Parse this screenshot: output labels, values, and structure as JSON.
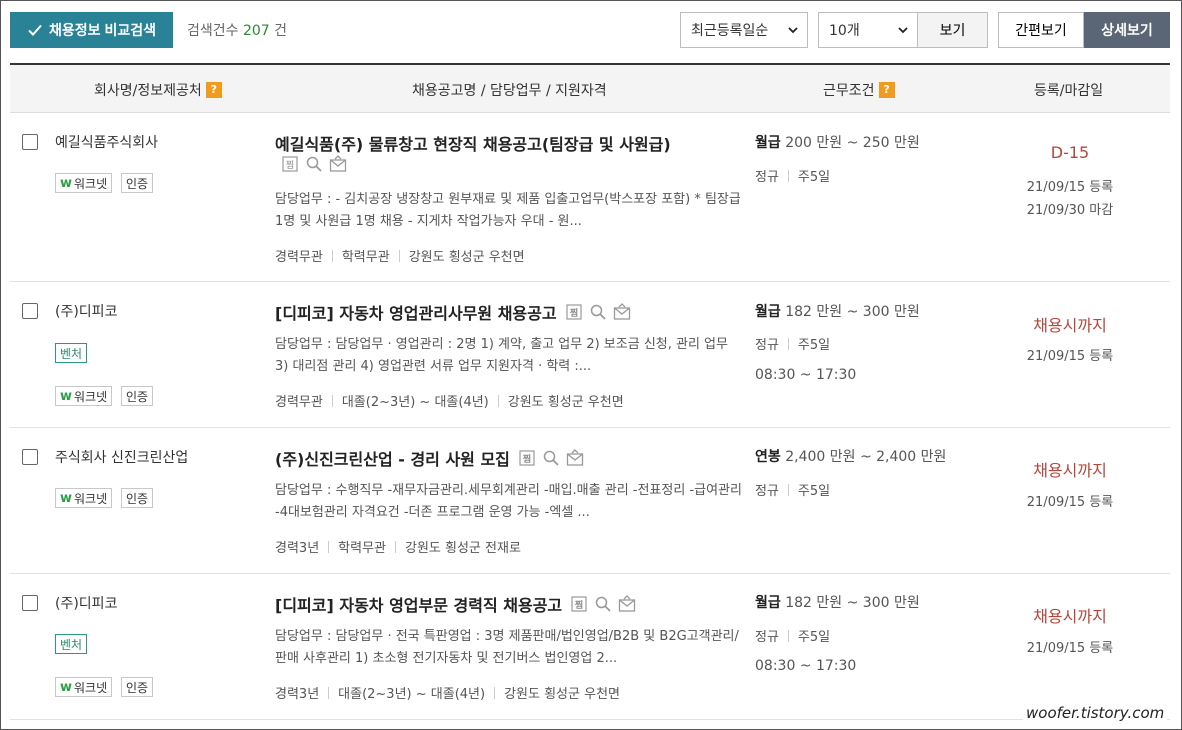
{
  "toolbar": {
    "compare_label": "채용정보 비교검색",
    "result_prefix": "검색건수",
    "result_count": "207",
    "result_suffix": "건",
    "sort_selected": "최근등록일순",
    "count_selected": "10개",
    "view_label": "보기",
    "simple_view_label": "간편보기",
    "detail_view_label": "상세보기"
  },
  "headers": {
    "company": "회사명/정보제공처",
    "title": "채용공고명 / 담당업무 / 지원자격",
    "condition": "근무조건",
    "date": "등록/마감일",
    "help_mark": "?"
  },
  "badges": {
    "worknet_mark": "w",
    "worknet": "워크넷",
    "certified": "인증",
    "venture": "벤처"
  },
  "rows": [
    {
      "company": "예길식품주식회사",
      "title": "예길식품(주) 물류창고 현장직 채용공고(팀장급 및 사원급)",
      "duty": "담당업무 : - 김치공장 냉장창고 원부재료 및 제품 입출고업무(박스포장 포함) * 팀장급 1명 및 사원급 1명 채용 - 지게차 작업가능자 우대 - 원...",
      "career": "경력무관",
      "education": "학력무관",
      "location": "강원도 횡성군 우천면",
      "pay_type": "월급",
      "pay_range": "200 만원 ~ 250 만원",
      "employment": "정규",
      "week": "주5일",
      "deadline": "D-15",
      "registered": "21/09/15 등록",
      "closing": "21/09/30 마감"
    },
    {
      "company": "(주)디피코",
      "title": "[디피코] 자동차 영업관리사무원 채용공고",
      "duty": "담당업무 : 담당업무 · 영업관리 : 2명 1) 계약, 출고 업무 2) 보조금 신청, 관리 업무 3) 대리점 관리 4) 영업관련 서류 업무 지원자격 · 학력 :...",
      "career": "경력무관",
      "education": "대졸(2~3년) ~ 대졸(4년)",
      "location": "강원도 횡성군 우천면",
      "pay_type": "월급",
      "pay_range": "182 만원 ~ 300 만원",
      "employment": "정규",
      "week": "주5일",
      "hours": "08:30 ~ 17:30",
      "deadline": "채용시까지",
      "registered": "21/09/15 등록"
    },
    {
      "company": "주식회사 신진크린산업",
      "title": "(주)신진크린산업 - 경리 사원 모집",
      "duty": "담당업무 : 수행직무 -재무자금관리.세무회계관리 -매입.매출 관리 -전표정리 -급여관리 -4대보험관리 자격요건 -더존 프로그램 운영 가능 -엑셀 ...",
      "career": "경력3년",
      "education": "학력무관",
      "location": "강원도 횡성군 전재로",
      "pay_type": "연봉",
      "pay_range": "2,400 만원 ~ 2,400 만원",
      "employment": "정규",
      "week": "주5일",
      "deadline": "채용시까지",
      "registered": "21/09/15 등록"
    },
    {
      "company": "(주)디피코",
      "title": "[디피코] 자동차 영업부문 경력직 채용공고",
      "duty": "담당업무 : 담당업무 · 전국 특판영업 : 3명 제품판매/법인영업/B2B 및 B2G고객관리/판매 사후관리 1) 초소형 전기자동차 및 전기버스 법인영업 2...",
      "career": "경력3년",
      "education": "대졸(2~3년) ~ 대졸(4년)",
      "location": "강원도 횡성군 우천면",
      "pay_type": "월급",
      "pay_range": "182 만원 ~ 300 만원",
      "employment": "정규",
      "week": "주5일",
      "hours": "08:30 ~ 17:30",
      "deadline": "채용시까지",
      "registered": "21/09/15 등록"
    }
  ],
  "watermark": "woofer.tistory.com",
  "colors": {
    "accent": "#2a8296",
    "help": "#f29a1d",
    "deadline": "#b5463c",
    "count": "#2a8a2a",
    "detail_active": "#5a6575"
  },
  "icons": [
    "check-icon",
    "chevron-down-icon",
    "scrap-icon",
    "search-icon",
    "mail-icon",
    "help-icon"
  ]
}
